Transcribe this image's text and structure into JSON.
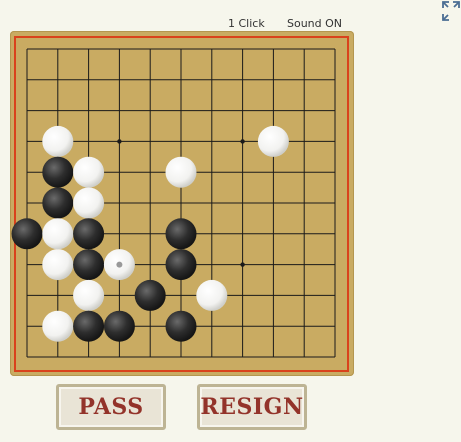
{
  "header": {
    "click_mode": "1 Click",
    "sound": "Sound ON"
  },
  "icons": {
    "fullscreen": "fullscreen-expand-icon"
  },
  "board": {
    "size": 11,
    "frame_color": "#c9ab62",
    "border_color": "#d9421c",
    "line_color": "#1a1a1a",
    "star_points": [
      [
        3,
        3
      ],
      [
        7,
        3
      ],
      [
        3,
        7
      ],
      [
        7,
        7
      ]
    ],
    "last_move": [
      3,
      7
    ],
    "stones": [
      {
        "c": "white",
        "col": 1,
        "row": 3
      },
      {
        "c": "white",
        "col": 8,
        "row": 3
      },
      {
        "c": "black",
        "col": 1,
        "row": 4
      },
      {
        "c": "white",
        "col": 2,
        "row": 4
      },
      {
        "c": "white",
        "col": 5,
        "row": 4
      },
      {
        "c": "black",
        "col": 1,
        "row": 5
      },
      {
        "c": "white",
        "col": 2,
        "row": 5
      },
      {
        "c": "black",
        "col": 0,
        "row": 6
      },
      {
        "c": "white",
        "col": 1,
        "row": 6
      },
      {
        "c": "black",
        "col": 2,
        "row": 6
      },
      {
        "c": "black",
        "col": 5,
        "row": 6
      },
      {
        "c": "white",
        "col": 1,
        "row": 7
      },
      {
        "c": "black",
        "col": 2,
        "row": 7
      },
      {
        "c": "white",
        "col": 3,
        "row": 7
      },
      {
        "c": "black",
        "col": 5,
        "row": 7
      },
      {
        "c": "white",
        "col": 2,
        "row": 8
      },
      {
        "c": "black",
        "col": 4,
        "row": 8
      },
      {
        "c": "white",
        "col": 6,
        "row": 8
      },
      {
        "c": "white",
        "col": 1,
        "row": 9
      },
      {
        "c": "black",
        "col": 2,
        "row": 9
      },
      {
        "c": "black",
        "col": 3,
        "row": 9
      },
      {
        "c": "black",
        "col": 5,
        "row": 9
      }
    ]
  },
  "buttons": {
    "pass": "PASS",
    "resign": "RESIGN"
  }
}
